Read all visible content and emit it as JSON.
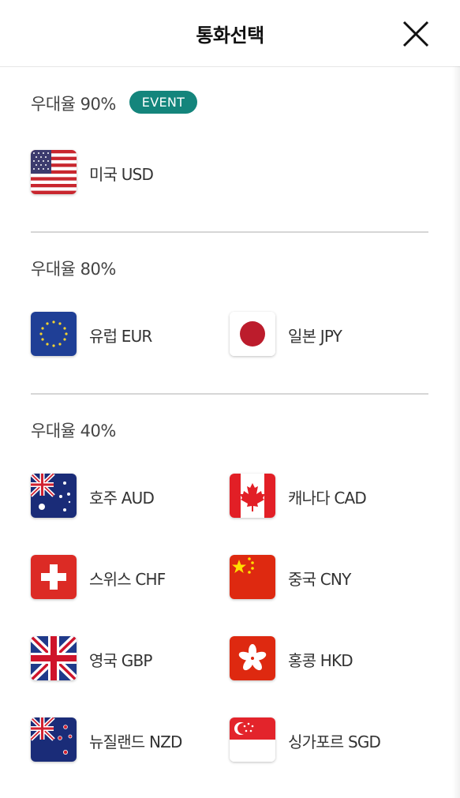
{
  "header": {
    "title": "통화선택"
  },
  "sections": [
    {
      "title": "우대율 90%",
      "badge": "EVENT",
      "items": [
        {
          "label": "미국 USD",
          "flag": "us-flag-icon"
        }
      ]
    },
    {
      "title": "우대율 80%",
      "items": [
        {
          "label": "유럽 EUR",
          "flag": "eu-flag-icon"
        },
        {
          "label": "일본 JPY",
          "flag": "jp-flag-icon"
        }
      ]
    },
    {
      "title": "우대율 40%",
      "items": [
        {
          "label": "호주 AUD",
          "flag": "au-flag-icon"
        },
        {
          "label": "캐나다 CAD",
          "flag": "ca-flag-icon"
        },
        {
          "label": "스위스 CHF",
          "flag": "ch-flag-icon"
        },
        {
          "label": "중국 CNY",
          "flag": "cn-flag-icon"
        },
        {
          "label": "영국 GBP",
          "flag": "gb-flag-icon"
        },
        {
          "label": "홍콩 HKD",
          "flag": "hk-flag-icon"
        },
        {
          "label": "뉴질랜드 NZD",
          "flag": "nz-flag-icon"
        },
        {
          "label": "싱가포르 SGD",
          "flag": "sg-flag-icon"
        }
      ]
    }
  ],
  "colors": {
    "badge": "#14857c",
    "divider": "#d6d6d6"
  }
}
